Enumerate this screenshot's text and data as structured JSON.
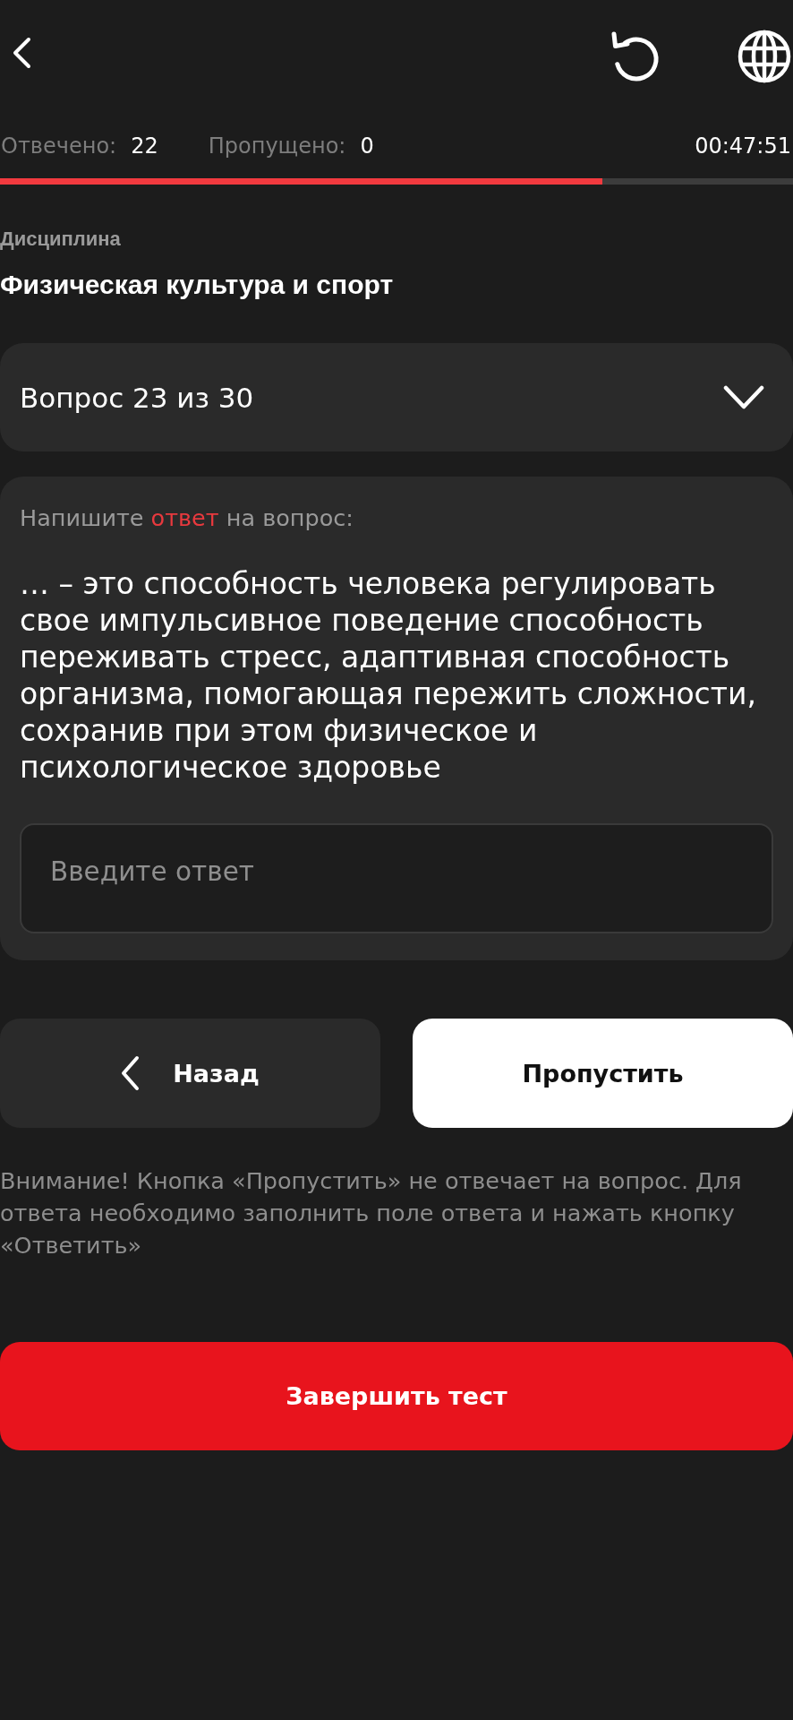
{
  "stats": [
    {
      "label": "Отвечено:",
      "value": "22"
    },
    {
      "label": "Пропущено:",
      "value": "0"
    }
  ],
  "timer": "00:47:51",
  "progress": {
    "level": 0.76
  },
  "discipline": {
    "label": "Дисциплина",
    "name": "Физическая культура и спорт"
  },
  "question_selector": {
    "label": "Вопрос 23 из 30",
    "expanded": false
  },
  "question": {
    "prompt": [
      {
        "text": "Напишите ",
        "highlight": false
      },
      {
        "text": "ответ",
        "highlight": true
      },
      {
        "text": " на вопрос:",
        "highlight": false
      }
    ],
    "text": "… – это способность человека регулировать свое импульсивное поведение способность переживать стресс, адаптивная способность организма, помогающая пережить сложности, сохранив при этом физическое и психологическое здоровье",
    "answer": {
      "placeholder": "Введите ответ"
    }
  },
  "buttons": [
    {
      "kind": "secondary",
      "label": "Назад"
    },
    {
      "kind": "primary",
      "label": "Пропустить"
    }
  ],
  "notice": "Внимание! Кнопка «Пропустить» не отвечает на вопрос. Для ответа необходимо заполнить поле ответа и нажать кнопку «Ответить»",
  "finish_button": {
    "label": "Завершить тест"
  }
}
